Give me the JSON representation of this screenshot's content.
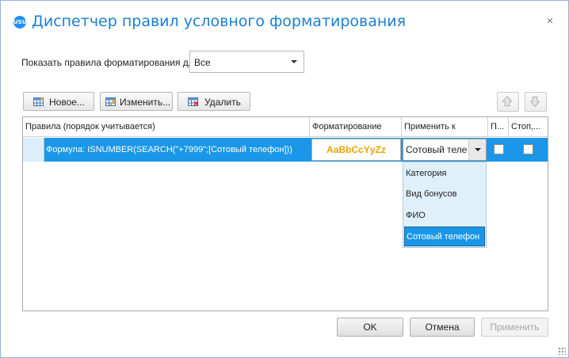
{
  "window": {
    "title": "Диспетчер правил условного форматирования",
    "icon_text": "USU",
    "close_glyph": "×"
  },
  "filter": {
    "label": "Показать правила форматирования для:",
    "value": "Все"
  },
  "toolbar": {
    "new_label": "Новое...",
    "edit_label": "Изменить...",
    "delete_label": "Удалить"
  },
  "grid": {
    "columns": [
      "Правила (порядок учитывается)",
      "Форматирование",
      "Применить к",
      "П...",
      "Стоп,..."
    ],
    "rows": [
      {
        "rule": "Формула: ISNUMBER(SEARCH(\"+7999\";[Сотовый телефон]))",
        "preview": "AaBbCcYyZz",
        "apply_to": "Сотовый телефон",
        "preview_color": "#e8a400"
      }
    ]
  },
  "dropdown": {
    "options": [
      "Категория",
      "Вид бонусов",
      "ФИО",
      "Сотовый телефон"
    ],
    "selected": "Сотовый телефон"
  },
  "footer": {
    "ok_label": "OK",
    "cancel_label": "Отмена",
    "apply_label": "Применить"
  },
  "colors": {
    "accent": "#1a7fd4",
    "selection": "#1a97e8"
  }
}
